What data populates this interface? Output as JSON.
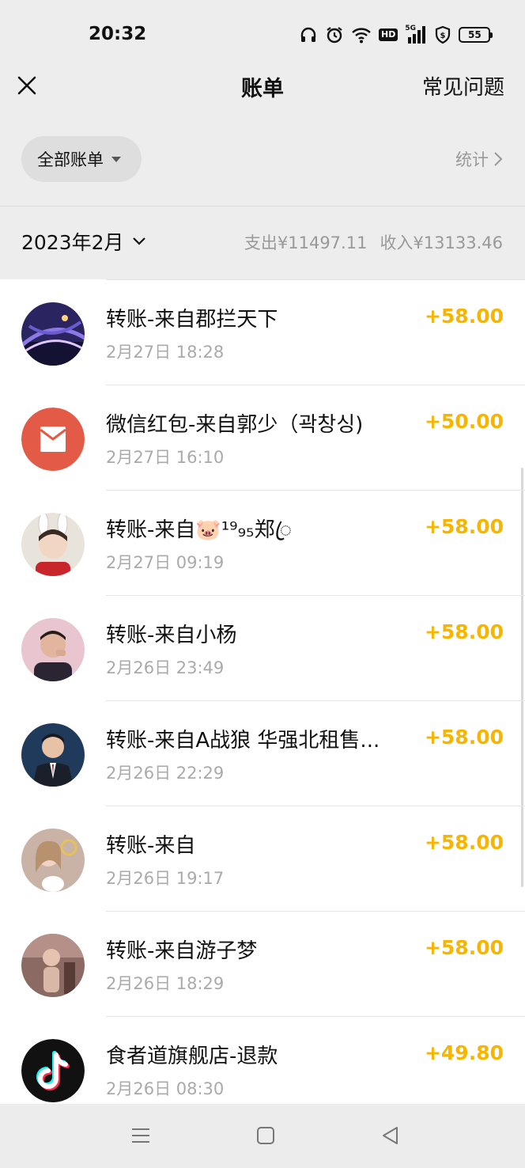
{
  "status_bar": {
    "time": "20:32",
    "hd": "HD",
    "network": "5G",
    "battery": "55",
    "icons": [
      "headphones-icon",
      "alarm-icon",
      "wifi-icon",
      "hd-icon",
      "signal-icon",
      "shield-icon",
      "battery-icon"
    ]
  },
  "nav": {
    "title": "账单",
    "right_link": "常见问题",
    "left_icon": "close-icon"
  },
  "filter": {
    "selected": "全部账单",
    "stats_link": "统计"
  },
  "month": {
    "label": "2023年2月",
    "expense": "支出¥11497.11",
    "income": "收入¥13133.46"
  },
  "transactions": [
    {
      "title": "转账-来自郡拦天下",
      "time": "2月27日 18:28",
      "amount": "+58.00",
      "avatar": "night-highway-photo"
    },
    {
      "title": "微信红包-来自郭少（곽창싱)",
      "time": "2月27日 16:10",
      "amount": "+50.00",
      "avatar": "red-packet-icon"
    },
    {
      "title": "转账-来自🐷¹⁹₉₅郑ꦿ",
      "time": "2月27日 09:19",
      "amount": "+58.00",
      "avatar": "person-bunny-ears-photo"
    },
    {
      "title": "转账-来自小杨",
      "time": "2月26日 23:49",
      "amount": "+58.00",
      "avatar": "person-photo"
    },
    {
      "title": "转账-来自A战狼 华强北租售...",
      "time": "2月26日 22:29",
      "amount": "+58.00",
      "avatar": "man-in-suit-photo"
    },
    {
      "title": "转账-来自",
      "time": "2月26日 19:17",
      "amount": "+58.00",
      "avatar": "woman-photo"
    },
    {
      "title": "转账-来自游子梦",
      "time": "2月26日 18:29",
      "amount": "+58.00",
      "avatar": "person-photo"
    },
    {
      "title": "食者道旗舰店-退款",
      "time": "2月26日 08:30",
      "amount": "+49.80",
      "avatar": "tiktok-logo"
    }
  ],
  "colors": {
    "amount": "#f7b500",
    "background": "#ededed",
    "list_bg": "#ffffff",
    "red_packet": "#e35a47"
  },
  "system_nav": [
    "menu-icon",
    "home-icon",
    "back-icon"
  ]
}
